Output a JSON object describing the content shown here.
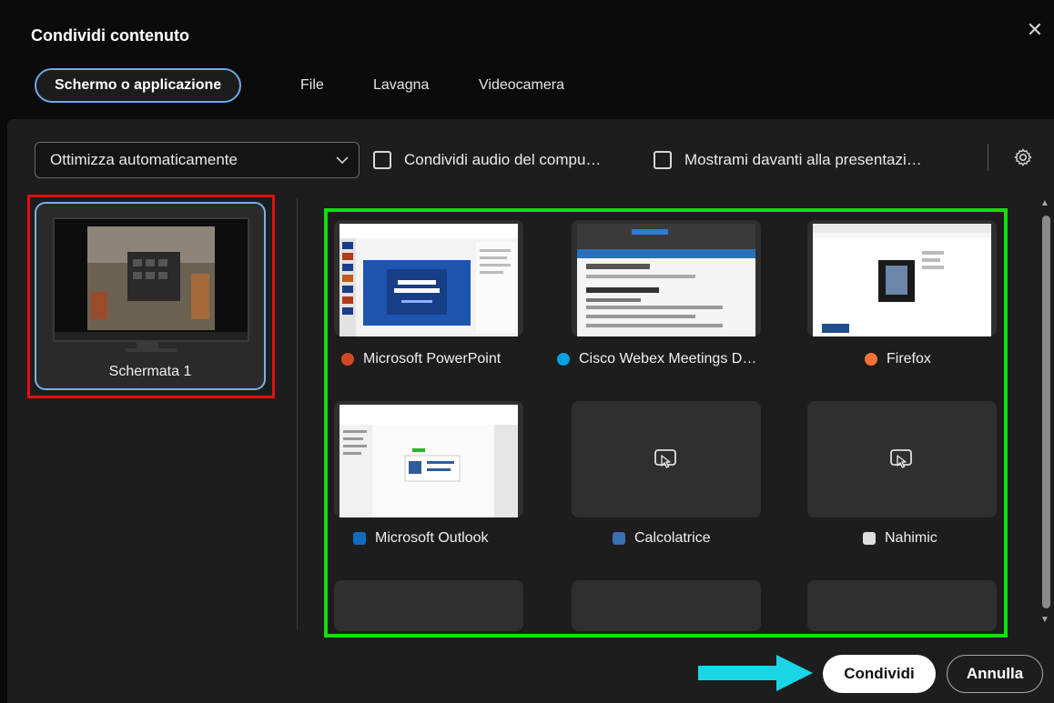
{
  "dialog": {
    "title": "Condividi contenuto",
    "close_glyph": "✕"
  },
  "tabs": [
    {
      "label": "Schermo o applicazione",
      "active": true
    },
    {
      "label": "File"
    },
    {
      "label": "Lavagna"
    },
    {
      "label": "Videocamera"
    }
  ],
  "options": {
    "optimize": {
      "selected": "Ottimizza automaticamente"
    },
    "share_audio": {
      "label": "Condividi audio del compu…",
      "checked": false
    },
    "show_me_in_front": {
      "label": "Mostrami davanti alla presentazi…",
      "checked": false
    },
    "settings_icon": "gear-icon"
  },
  "screens": [
    {
      "label": "Schermata 1",
      "selected": true
    }
  ],
  "apps": [
    {
      "label": "Microsoft PowerPoint",
      "icon_color": "#d24726",
      "thumbnail": "powerpoint"
    },
    {
      "label": "Cisco Webex Meetings D…",
      "icon_color": "#00a3e0",
      "thumbnail": "webex"
    },
    {
      "label": "Firefox",
      "icon_color": "#ff7139",
      "thumbnail": "firefox"
    },
    {
      "label": "Microsoft Outlook",
      "icon_color": "#0f6cbd",
      "thumbnail": "outlook"
    },
    {
      "label": "Calcolatrice",
      "icon_color": "#3a6fb0",
      "thumbnail": "none"
    },
    {
      "label": "Nahimic",
      "icon_color": "#dddddd",
      "thumbnail": "none"
    }
  ],
  "footer": {
    "share_label": "Condividi",
    "cancel_label": "Annulla"
  },
  "colors": {
    "red_annotation": "#e01010",
    "green_annotation": "#10e010",
    "arrow_annotation": "#19d6e6",
    "selected_border": "#7ab0e8"
  }
}
